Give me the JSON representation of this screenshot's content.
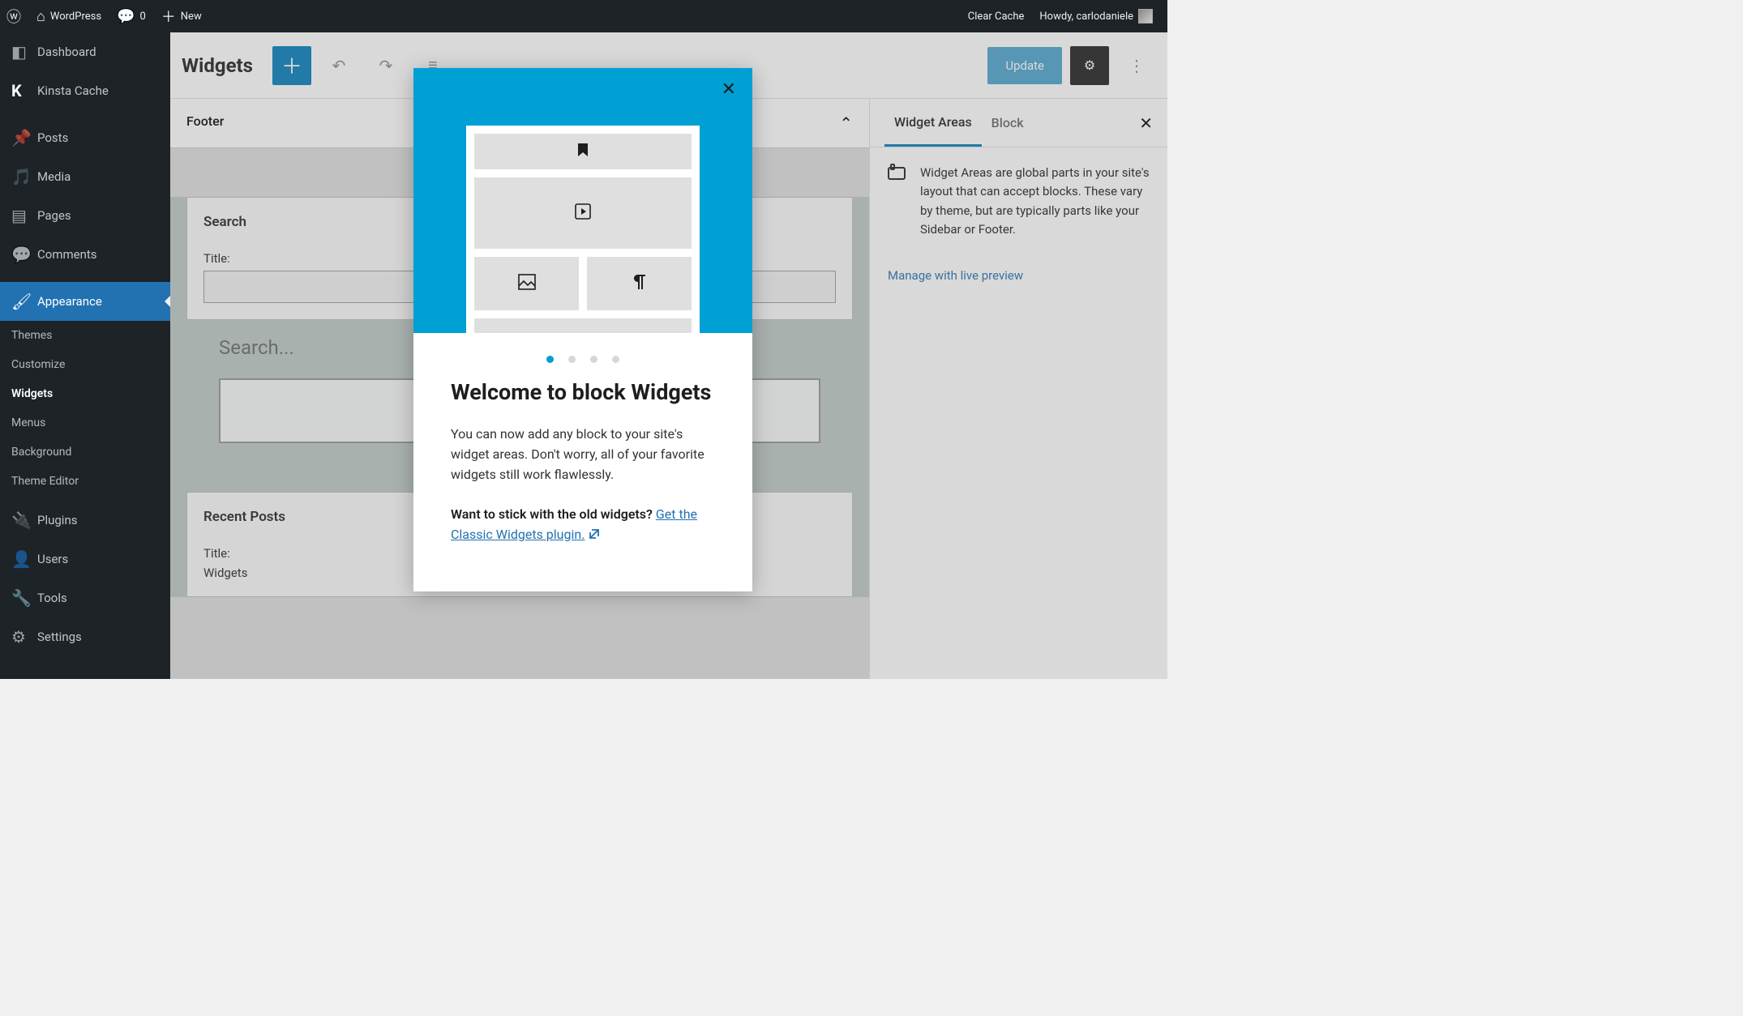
{
  "adminbar": {
    "site_name": "WordPress",
    "comments_count": "0",
    "new_label": "New",
    "clear_cache": "Clear Cache",
    "howdy": "Howdy, carlodaniele"
  },
  "sidebar": {
    "items": [
      {
        "label": "Dashboard",
        "icon": "dashboard"
      },
      {
        "label": "Kinsta Cache",
        "icon": "kinsta"
      },
      {
        "label": "Posts",
        "icon": "pin"
      },
      {
        "label": "Media",
        "icon": "media"
      },
      {
        "label": "Pages",
        "icon": "page"
      },
      {
        "label": "Comments",
        "icon": "comment"
      },
      {
        "label": "Appearance",
        "icon": "brush",
        "current": true
      },
      {
        "label": "Plugins",
        "icon": "plug"
      },
      {
        "label": "Users",
        "icon": "user"
      },
      {
        "label": "Tools",
        "icon": "wrench"
      },
      {
        "label": "Settings",
        "icon": "settings"
      }
    ],
    "submenu": [
      {
        "label": "Themes"
      },
      {
        "label": "Customize"
      },
      {
        "label": "Widgets",
        "active": true
      },
      {
        "label": "Menus"
      },
      {
        "label": "Background"
      },
      {
        "label": "Theme Editor"
      }
    ]
  },
  "editor": {
    "title": "Widgets",
    "update": "Update"
  },
  "canvas": {
    "area_name": "Footer",
    "search_card": {
      "title": "Search",
      "field_label": "Title:"
    },
    "search_heading": "Search...",
    "recent_card": {
      "title": "Recent Posts",
      "field_label": "Title:",
      "value": "Widgets"
    }
  },
  "panel": {
    "tab1": "Widget Areas",
    "tab2": "Block",
    "desc": "Widget Areas are global parts in your site's layout that can accept blocks. These vary by theme, but are typically parts like your Sidebar or Footer.",
    "manage": "Manage with live preview"
  },
  "modal": {
    "title": "Welcome to block Widgets",
    "body": "You can now add any block to your site's widget areas. Don't worry, all of your favorite widgets still work flawlessly.",
    "alt_q": "Want to stick with the old widgets? ",
    "alt_link": "Get the Classic Widgets plugin."
  }
}
